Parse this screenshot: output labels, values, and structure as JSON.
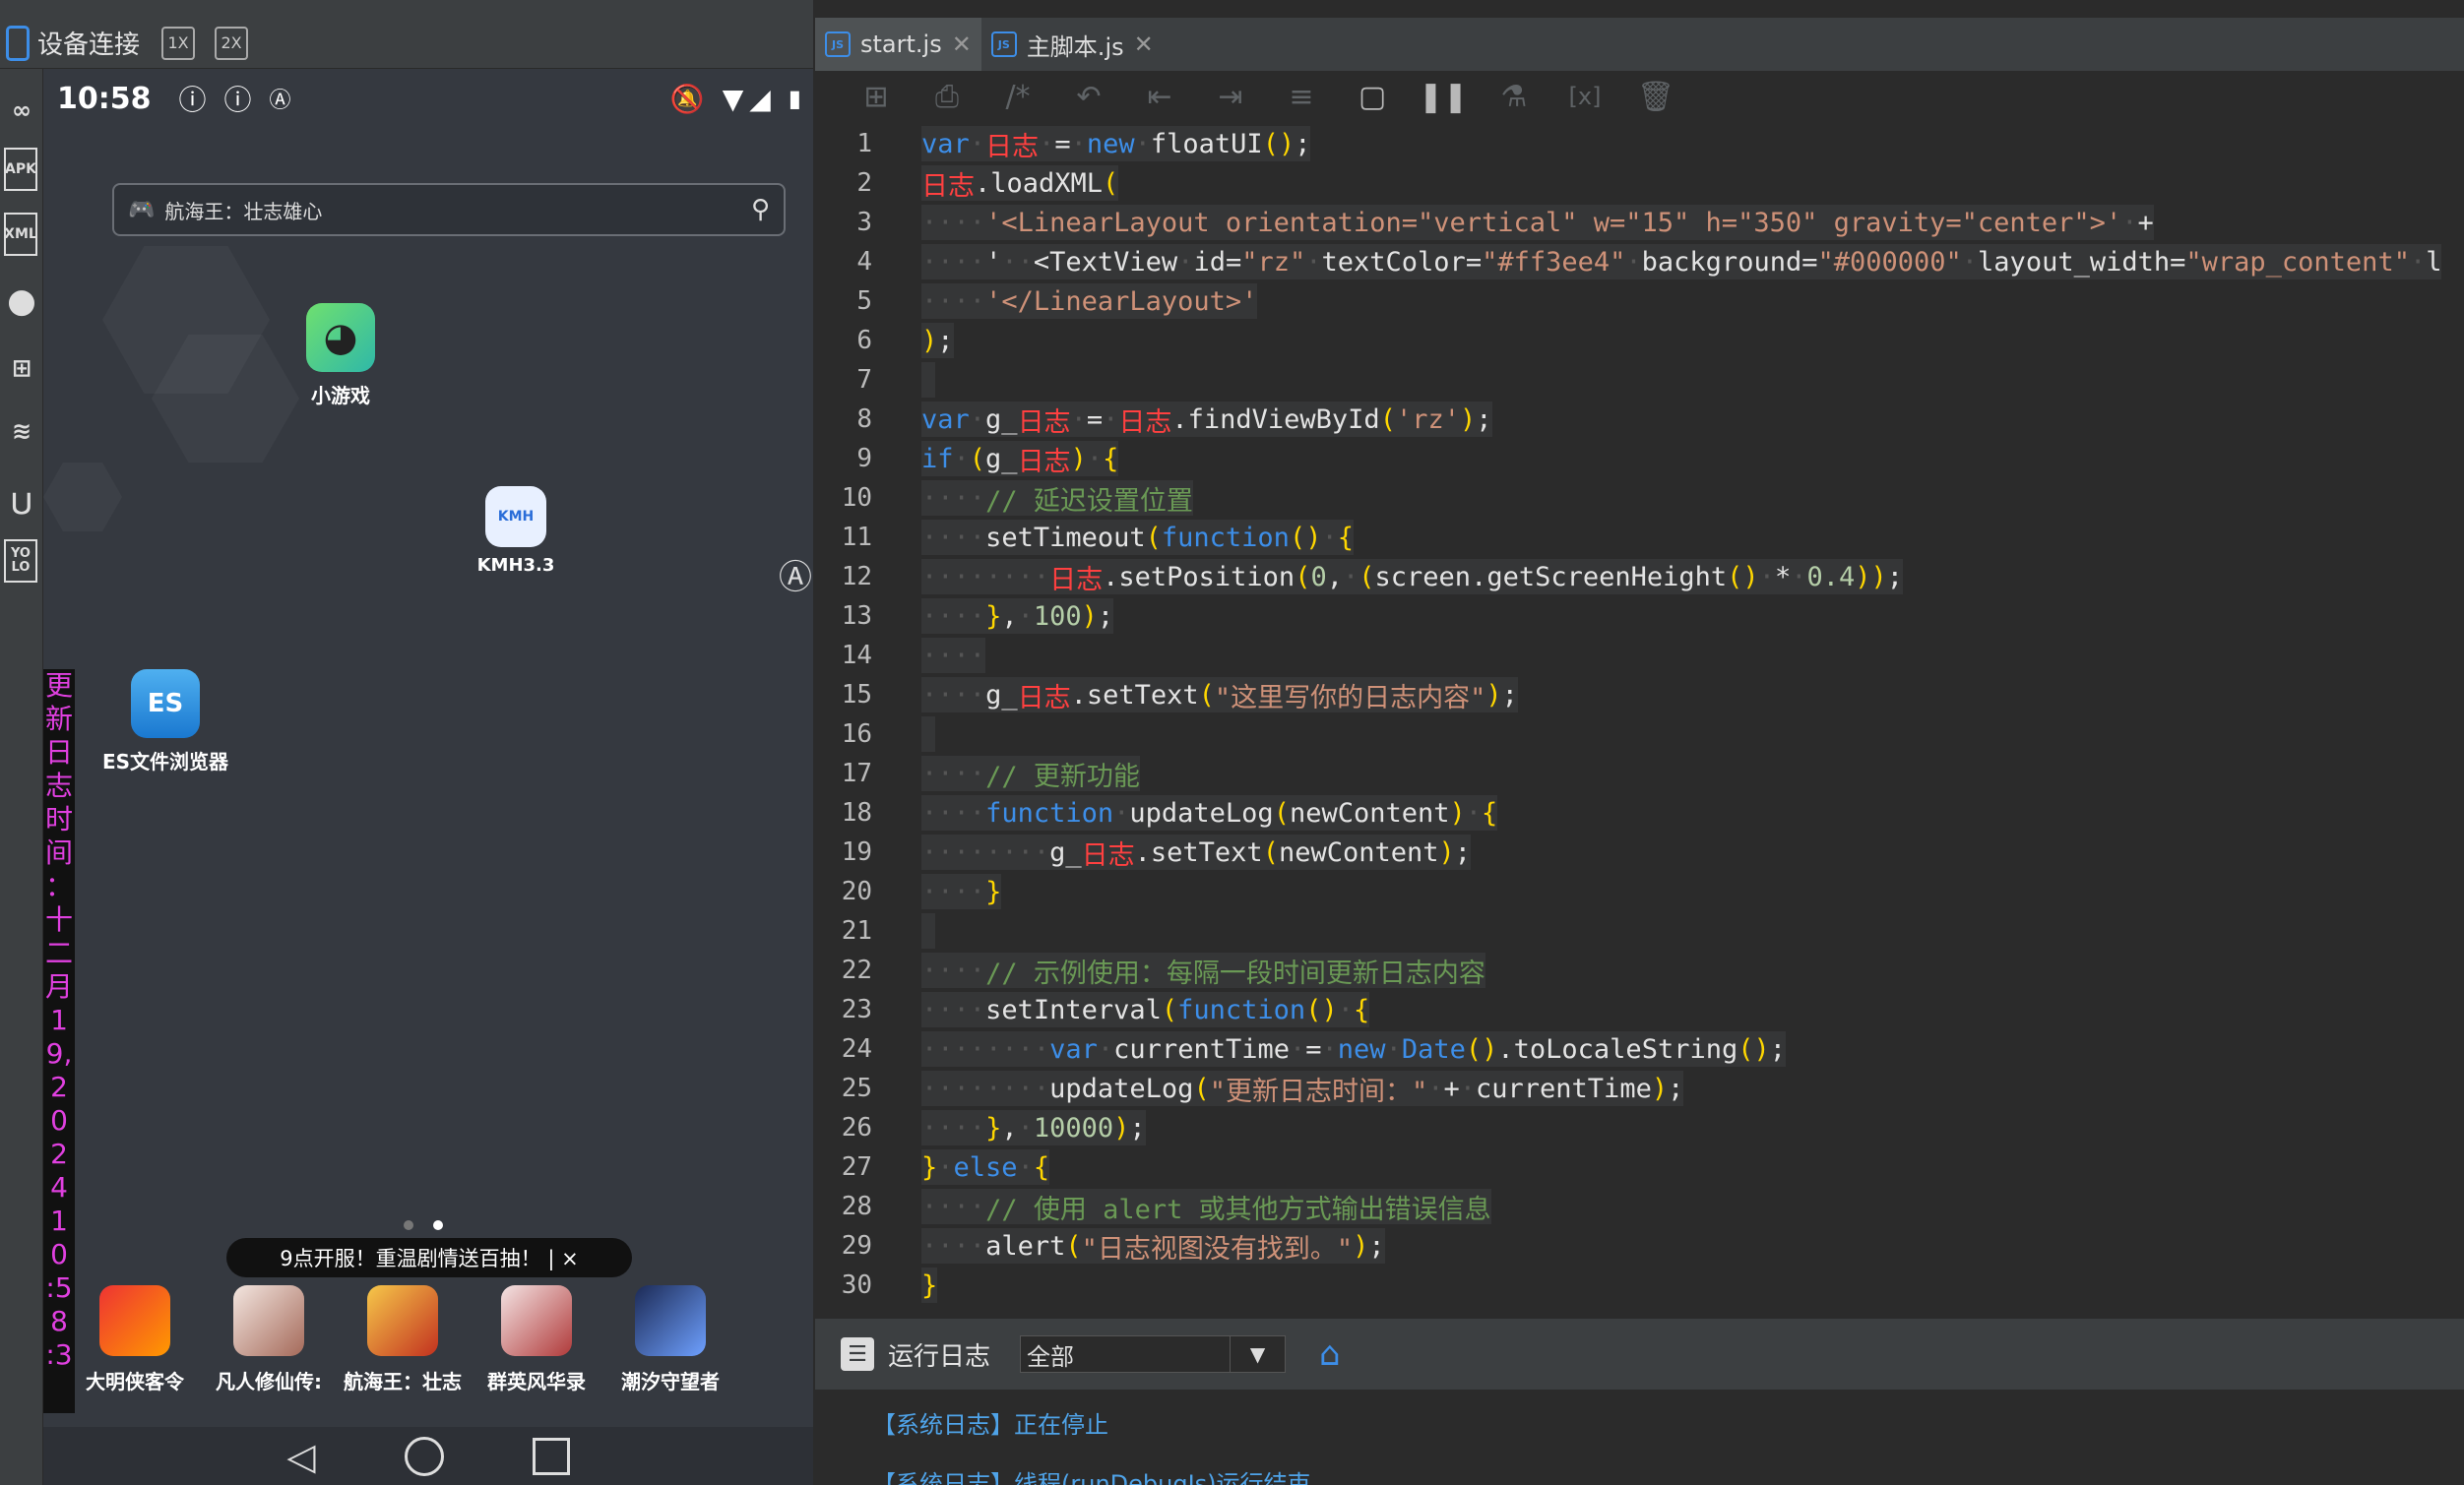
{
  "device_panel": {
    "title": "设备连接",
    "scale_1x": "1X",
    "scale_2x": "2X",
    "side_tools": [
      "link-icon",
      "apk-icon",
      "xml-icon",
      "palette-icon",
      "tree-icon",
      "wifi-icon",
      "usb-icon",
      "yolo-icon"
    ],
    "phone": {
      "time": "10:58",
      "search_text": "航海王：壮志雄心",
      "apps": [
        {
          "label": "小游戏"
        },
        {
          "label": "KMH3.3"
        },
        {
          "label": "ES文件浏览器"
        }
      ],
      "vertical_log": [
        "更",
        "新",
        "日",
        "志",
        "时",
        "间",
        "：",
        "十",
        "二",
        "月",
        "1",
        "9,",
        "2",
        "0",
        "2",
        "4",
        "1",
        "0",
        ":5",
        "8",
        ":3"
      ],
      "banner": "9点开服！重温剧情送百抽！ | ×",
      "dock": [
        {
          "label": "大明侠客令"
        },
        {
          "label": "凡人修仙传:"
        },
        {
          "label": "航海王：壮志"
        },
        {
          "label": "群英风华录"
        },
        {
          "label": "潮汐守望者"
        }
      ]
    }
  },
  "editor": {
    "tabs": [
      {
        "label": "start.js",
        "active": true
      },
      {
        "label": "主脚本.js",
        "active": false
      }
    ],
    "toolbar_icons": [
      "add-icon",
      "print-icon",
      "comment-icon",
      "undo-icon",
      "outdent-icon",
      "indent-icon",
      "format-icon",
      "stop-icon",
      "pause-icon",
      "flask-icon",
      "variables-icon",
      "delete-icon"
    ]
  },
  "code_lines": [
    "var 日志 = new floatUI();",
    "日志.loadXML(",
    "    '<LinearLayout orientation=\"vertical\" w=\"15\" h=\"350\" gravity=\"center\">' +",
    "    '  <TextView id=\"rz\" textColor=\"#ff3ee4\" background=\"#000000\" layout_width=\"wrap_content\" l",
    "    '</LinearLayout>'",
    ");",
    "",
    "var g_日志 = 日志.findViewById('rz');",
    "if (g_日志) {",
    "    // 延迟设置位置",
    "    setTimeout(function() {",
    "        日志.setPosition(0, (screen.getScreenHeight() * 0.4));",
    "    }, 100);",
    "    ",
    "    g_日志.setText(\"这里写你的日志内容\");",
    "",
    "    // 更新功能",
    "    function updateLog(newContent) {",
    "        g_日志.setText(newContent);",
    "    }",
    "",
    "    // 示例使用：每隔一段时间更新日志内容",
    "    setInterval(function() {",
    "        var currentTime = new Date().toLocaleString();",
    "        updateLog(\"更新日志时间：\" + currentTime);",
    "    }, 10000);",
    "} else {",
    "    // 使用 alert 或其他方式输出错误信息",
    "    alert(\"日志视图没有找到。\");",
    "}"
  ],
  "log_panel": {
    "title": "运行日志",
    "filter_value": "全部",
    "lines": [
      "【系统日志】正在停止",
      "【系统日志】线程(runDebugJs)运行结束"
    ]
  },
  "colors": {
    "keyword": "#3d8ee8",
    "identifier_cn": "#ff4040",
    "string": "#ce9178",
    "comment": "#6a9955",
    "vertical_log": "#e040e0",
    "log_text": "#4fa3e8"
  }
}
